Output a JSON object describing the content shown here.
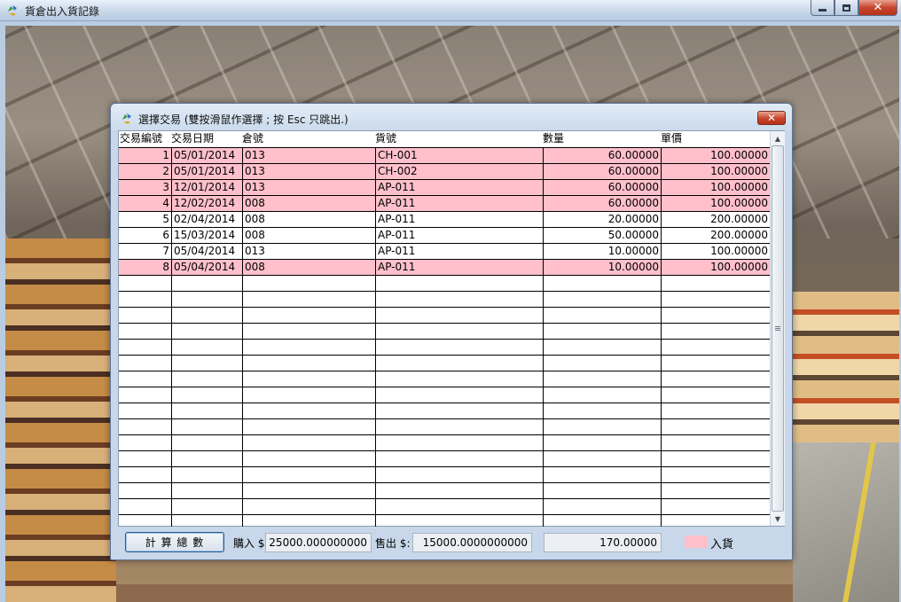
{
  "window": {
    "title": "貨倉出入貨記錄",
    "icon": "recycle-app-icon",
    "close_glyph": "✕"
  },
  "dialog": {
    "title": "選擇交易 (雙按滑鼠作選擇 ; 按 Esc 只跳出.)",
    "close_glyph": "✕"
  },
  "grid": {
    "columns": [
      "交易編號",
      "交易日期",
      "倉號",
      "貨號",
      "數量",
      "單價"
    ],
    "rows": [
      {
        "id": "1",
        "date": "05/01/2014",
        "warehouse": "013",
        "item": "CH-001",
        "qty": "60.00000",
        "price": "100.00000",
        "inbound": true
      },
      {
        "id": "2",
        "date": "05/01/2014",
        "warehouse": "013",
        "item": "CH-002",
        "qty": "60.00000",
        "price": "100.00000",
        "inbound": true
      },
      {
        "id": "3",
        "date": "12/01/2014",
        "warehouse": "013",
        "item": "AP-011",
        "qty": "60.00000",
        "price": "100.00000",
        "inbound": true
      },
      {
        "id": "4",
        "date": "12/02/2014",
        "warehouse": "008",
        "item": "AP-011",
        "qty": "60.00000",
        "price": "100.00000",
        "inbound": true
      },
      {
        "id": "5",
        "date": "02/04/2014",
        "warehouse": "008",
        "item": "AP-011",
        "qty": "20.00000",
        "price": "200.00000",
        "inbound": false
      },
      {
        "id": "6",
        "date": "15/03/2014",
        "warehouse": "008",
        "item": "AP-011",
        "qty": "50.00000",
        "price": "200.00000",
        "inbound": false
      },
      {
        "id": "7",
        "date": "05/04/2014",
        "warehouse": "013",
        "item": "AP-011",
        "qty": "10.00000",
        "price": "100.00000",
        "inbound": false
      },
      {
        "id": "8",
        "date": "05/04/2014",
        "warehouse": "008",
        "item": "AP-011",
        "qty": "10.00000",
        "price": "100.00000",
        "inbound": true
      }
    ],
    "empty_rows": 16,
    "inbound_color": "#ffc0cb"
  },
  "footer": {
    "calc_button": "計 算 總 數",
    "purchase_label": "購入 $",
    "purchase_value": "25000.000000000",
    "sale_label": "售出 $:",
    "sale_value": "15000.0000000000",
    "qty_total": "170.00000",
    "legend_label": "入貨"
  }
}
